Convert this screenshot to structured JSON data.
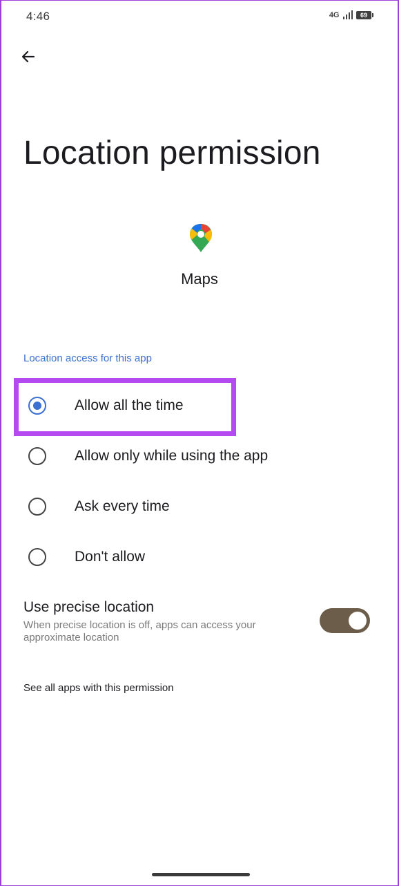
{
  "status_bar": {
    "time": "4:46",
    "network": "4G",
    "battery": "69"
  },
  "header": {
    "back_icon": "arrow-left-icon",
    "title": "Location permission"
  },
  "app": {
    "icon": "google-maps-pin-icon",
    "name": "Maps"
  },
  "section": {
    "header": "Location access for this app"
  },
  "options": [
    {
      "label": "Allow all the time",
      "selected": true
    },
    {
      "label": "Allow only while using the app",
      "selected": false
    },
    {
      "label": "Ask every time",
      "selected": false
    },
    {
      "label": "Don't allow",
      "selected": false
    }
  ],
  "precise_location": {
    "title": "Use precise location",
    "description": "When precise location is off, apps can access your approximate location",
    "enabled": true
  },
  "see_all": "See all apps with this permission",
  "colors": {
    "accent": "#3b6fd2",
    "highlight": "#b44bf0",
    "toggle_on": "#6b5d49"
  }
}
